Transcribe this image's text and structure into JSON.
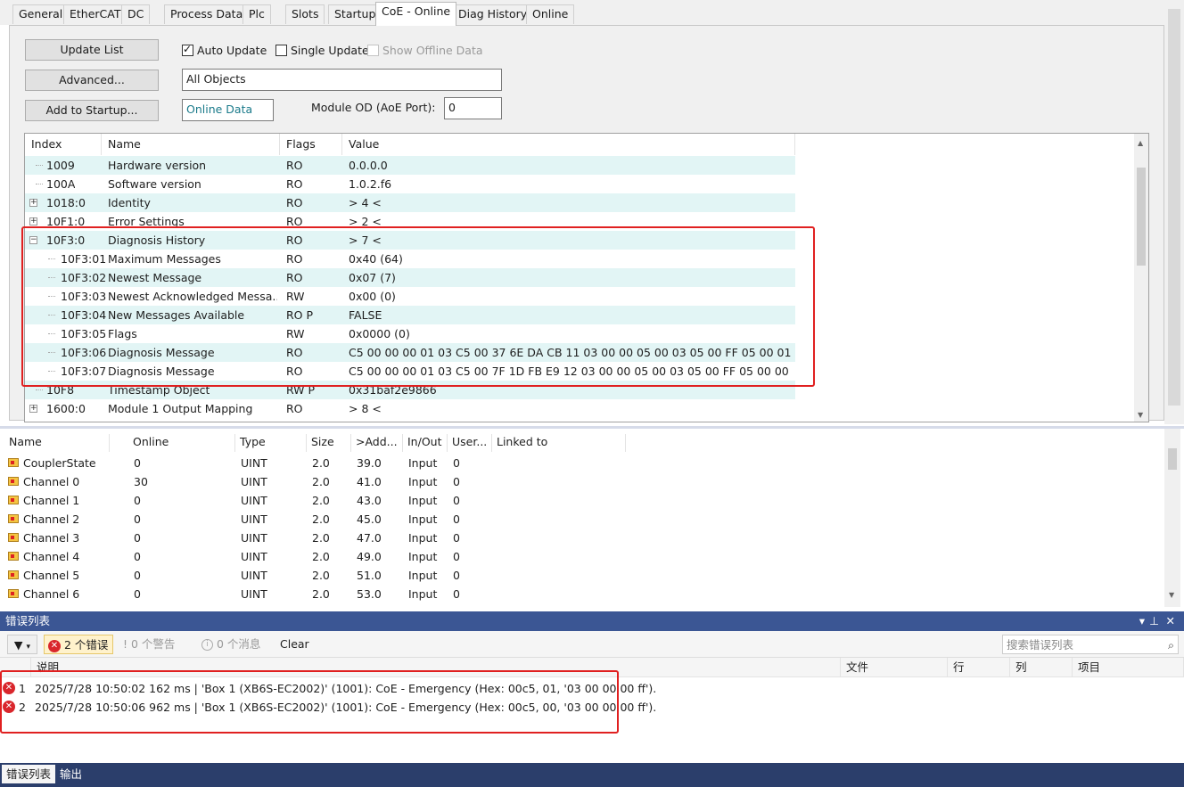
{
  "tabs": [
    "General",
    "EtherCAT",
    "DC",
    "Process Data",
    "Plc",
    "Slots",
    "Startup",
    "CoE - Online",
    "Diag History",
    "Online"
  ],
  "active_tab": "CoE - Online",
  "coe": {
    "update_list": "Update List",
    "advanced": "Advanced...",
    "add_to_startup": "Add to Startup...",
    "auto_update": "Auto Update",
    "single_update": "Single Update",
    "show_offline": "Show Offline Data",
    "filter_value": "All Objects",
    "online_data": "Online Data",
    "module_od_label": "Module OD (AoE Port):",
    "module_od_value": "0",
    "columns": [
      "Index",
      "Name",
      "Flags",
      "Value"
    ],
    "rows": [
      {
        "index": "1009",
        "name": "Hardware version",
        "flags": "RO",
        "value": "0.0.0.0"
      },
      {
        "index": "100A",
        "name": "Software version",
        "flags": "RO",
        "value": "1.0.2.f6"
      },
      {
        "index": "1018:0",
        "name": "Identity",
        "flags": "RO",
        "value": "> 4 <"
      },
      {
        "index": "10F1:0",
        "name": "Error Settings",
        "flags": "RO",
        "value": "> 2 <"
      },
      {
        "index": "10F3:0",
        "name": "Diagnosis History",
        "flags": "RO",
        "value": "> 7 <"
      },
      {
        "index": "10F3:01",
        "name": "Maximum Messages",
        "flags": "RO",
        "value": "0x40 (64)"
      },
      {
        "index": "10F3:02",
        "name": "Newest Message",
        "flags": "RO",
        "value": "0x07 (7)"
      },
      {
        "index": "10F3:03",
        "name": "Newest Acknowledged Messa...",
        "flags": "RW",
        "value": "0x00 (0)"
      },
      {
        "index": "10F3:04",
        "name": "New Messages Available",
        "flags": "RO P",
        "value": "FALSE"
      },
      {
        "index": "10F3:05",
        "name": "Flags",
        "flags": "RW",
        "value": "0x0000 (0)"
      },
      {
        "index": "10F3:06",
        "name": "Diagnosis Message",
        "flags": "RO",
        "value": "C5 00 00 00 01 03 C5 00 37 6E DA CB 11 03 00 00 05 00 03 05 00 FF 05 00 01"
      },
      {
        "index": "10F3:07",
        "name": "Diagnosis Message",
        "flags": "RO",
        "value": "C5 00 00 00 01 03 C5 00 7F 1D FB E9 12 03 00 00 05 00 03 05 00 FF 05 00 00"
      },
      {
        "index": "10F8",
        "name": "Timestamp Object",
        "flags": "RW P",
        "value": "0x31baf2e9866"
      },
      {
        "index": "1600:0",
        "name": "Module 1 Output Mapping",
        "flags": "RO",
        "value": "> 8 <"
      }
    ]
  },
  "vars": {
    "columns": [
      "Name",
      "Online",
      "Type",
      "Size",
      ">Add...",
      "In/Out",
      "User...",
      "Linked to"
    ],
    "rows": [
      {
        "name": "CouplerState",
        "online": "0",
        "type": "UINT",
        "size": "2.0",
        "addr": "39.0",
        "io": "Input",
        "user": "0"
      },
      {
        "name": "Channel 0",
        "online": "30",
        "type": "UINT",
        "size": "2.0",
        "addr": "41.0",
        "io": "Input",
        "user": "0"
      },
      {
        "name": "Channel 1",
        "online": "0",
        "type": "UINT",
        "size": "2.0",
        "addr": "43.0",
        "io": "Input",
        "user": "0"
      },
      {
        "name": "Channel 2",
        "online": "0",
        "type": "UINT",
        "size": "2.0",
        "addr": "45.0",
        "io": "Input",
        "user": "0"
      },
      {
        "name": "Channel 3",
        "online": "0",
        "type": "UINT",
        "size": "2.0",
        "addr": "47.0",
        "io": "Input",
        "user": "0"
      },
      {
        "name": "Channel 4",
        "online": "0",
        "type": "UINT",
        "size": "2.0",
        "addr": "49.0",
        "io": "Input",
        "user": "0"
      },
      {
        "name": "Channel 5",
        "online": "0",
        "type": "UINT",
        "size": "2.0",
        "addr": "51.0",
        "io": "Input",
        "user": "0"
      },
      {
        "name": "Channel 6",
        "online": "0",
        "type": "UINT",
        "size": "2.0",
        "addr": "53.0",
        "io": "Input",
        "user": "0"
      }
    ]
  },
  "errors": {
    "title": "错误列表",
    "errors_btn": "2 个错误",
    "warnings_btn": "0 个警告",
    "messages_btn": "0 个消息",
    "clear": "Clear",
    "search_placeholder": "搜索错误列表",
    "columns": [
      "说明",
      "文件",
      "行",
      "列",
      "项目"
    ],
    "rows": [
      {
        "num": "1",
        "text": "2025/7/28 10:50:02 162 ms  | 'Box 1 (XB6S-EC2002)' (1001): CoE - Emergency (Hex: 00c5, 01, '03 00 00 00 ff')."
      },
      {
        "num": "2",
        "text": "2025/7/28 10:50:06 962 ms  | 'Box 1 (XB6S-EC2002)' (1001): CoE - Emergency (Hex: 00c5, 00, '03 00 00 00 ff')."
      }
    ]
  },
  "bottom_tabs": [
    "错误列表",
    "输出"
  ]
}
